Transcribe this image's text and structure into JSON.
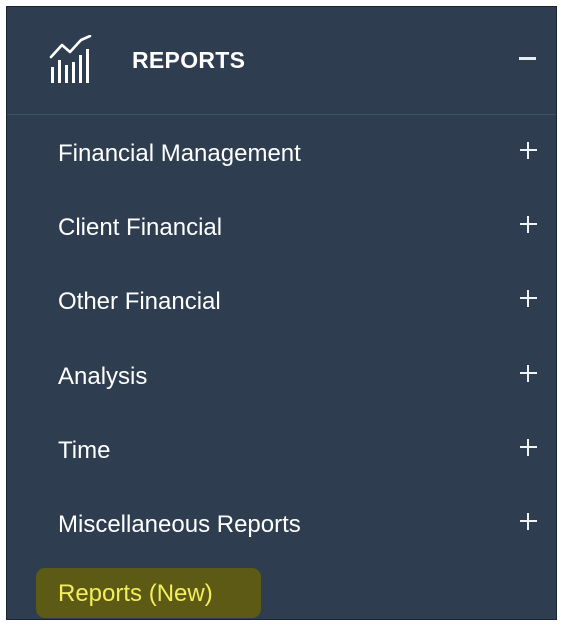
{
  "header": {
    "title": "REPORTS",
    "icon": "bar-chart-trend-icon",
    "collapse_icon": "minus-icon"
  },
  "menu": {
    "items": [
      {
        "label": "Financial Management",
        "expand_icon": "plus-icon"
      },
      {
        "label": "Client Financial",
        "expand_icon": "plus-icon"
      },
      {
        "label": "Other Financial",
        "expand_icon": "plus-icon"
      },
      {
        "label": "Analysis",
        "expand_icon": "plus-icon"
      },
      {
        "label": "Time",
        "expand_icon": "plus-icon"
      },
      {
        "label": "Miscellaneous Reports",
        "expand_icon": "plus-icon"
      },
      {
        "label": "Reports (New)",
        "highlighted": true
      }
    ]
  },
  "colors": {
    "panel_background": "#2e3e50",
    "text": "#ffffff",
    "highlight_background": "#5c5a15",
    "highlight_text": "#f3ee5c"
  }
}
